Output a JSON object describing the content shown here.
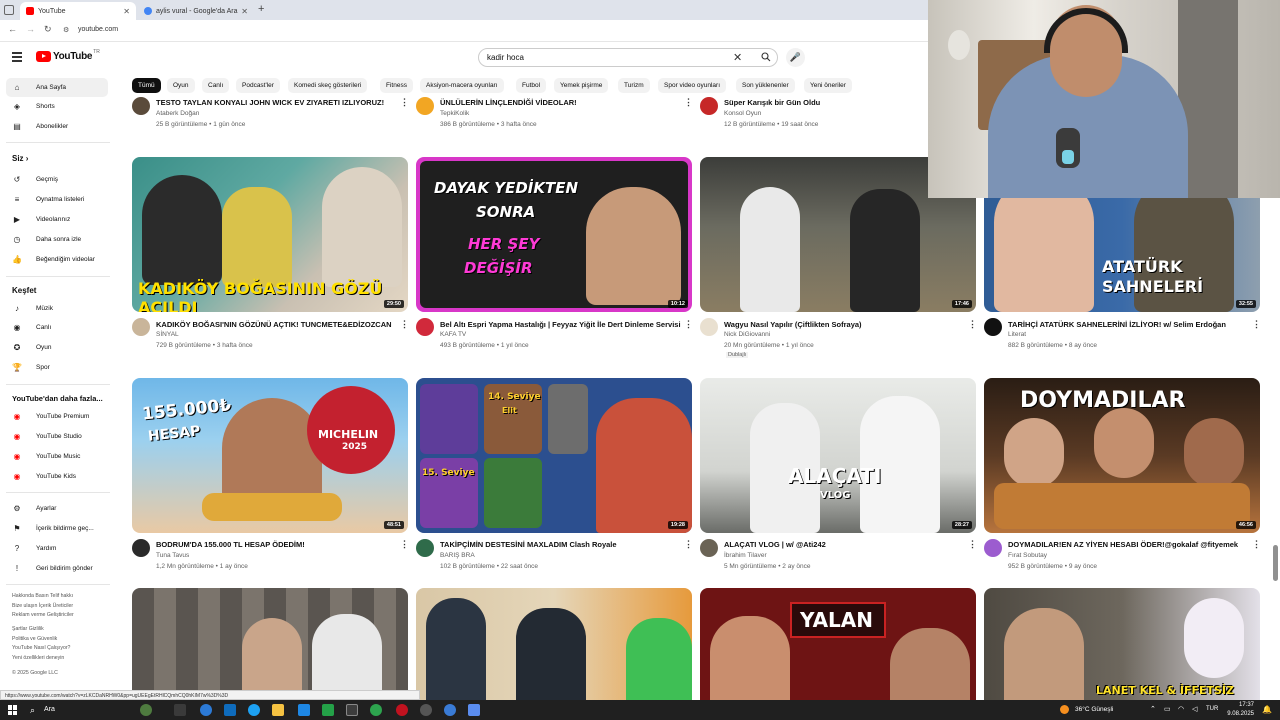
{
  "browser": {
    "tabs": [
      {
        "label": "YouTube",
        "active": true
      },
      {
        "label": "aylis vural - Google'da Ara",
        "active": false
      }
    ],
    "url": "youtube.com"
  },
  "masthead": {
    "logo_text": "YouTube",
    "logo_region": "TR",
    "search_value": "kadir hoca"
  },
  "sidebar": {
    "main": [
      {
        "label": "Ana Sayfa",
        "icon": "home-icon",
        "selected": true
      },
      {
        "label": "Shorts",
        "icon": "shorts-icon"
      },
      {
        "label": "Abonelikler",
        "icon": "subscriptions-icon"
      }
    ],
    "you_header": "Siz",
    "you": [
      {
        "label": "Geçmiş",
        "icon": "history-icon"
      },
      {
        "label": "Oynatma listeleri",
        "icon": "playlists-icon"
      },
      {
        "label": "Videolarınız",
        "icon": "your-videos-icon"
      },
      {
        "label": "Daha sonra izle",
        "icon": "watch-later-icon"
      },
      {
        "label": "Beğendiğim videolar",
        "icon": "liked-icon"
      }
    ],
    "explore_header": "Keşfet",
    "explore": [
      {
        "label": "Müzik",
        "icon": "music-icon"
      },
      {
        "label": "Canlı",
        "icon": "live-icon"
      },
      {
        "label": "Oyun",
        "icon": "gaming-icon"
      },
      {
        "label": "Spor",
        "icon": "sports-icon"
      }
    ],
    "more_header": "YouTube'dan daha fazla...",
    "more": [
      {
        "label": "YouTube Premium"
      },
      {
        "label": "YouTube Studio"
      },
      {
        "label": "YouTube Music"
      },
      {
        "label": "YouTube Kids"
      }
    ],
    "settings": [
      {
        "label": "Ayarlar",
        "icon": "settings-icon"
      },
      {
        "label": "İçerik bildirme geç...",
        "icon": "flag-icon"
      },
      {
        "label": "Yardım",
        "icon": "help-icon"
      },
      {
        "label": "Geri bildirim gönder",
        "icon": "feedback-icon"
      }
    ],
    "footer1": "Hakkında  Basın  Telif hakkı",
    "footer2": "Bize ulaşın  İçerik Üreticiler",
    "footer3": "Reklam verme  Geliştiriciler",
    "footer4": "Şartlar  Gizlilik",
    "footer5": "Politika ve Güvenlik",
    "footer6": "YouTube Nasıl Çalışıyor?",
    "footer7": "Yeni özellikleri deneyin",
    "copyright": "© 2025 Google LLC"
  },
  "chips": [
    "Tümü",
    "Oyun",
    "Canlı",
    "Podcast'ler",
    "Komedi skeç gösterileri",
    "Fitness",
    "Aksiyon-macera oyunları",
    "Futbol",
    "Yemek pişirme",
    "Turizm",
    "Spor video oyunları",
    "Son yüklenenler",
    "Yeni öneriler"
  ],
  "row0": [
    {
      "title": "TESTO TAYLAN KONYALI JOHN WICK EV ZIYARETI IZLIYORUZ!",
      "channel": "Ataberk Doğan",
      "meta": "25 B görüntüleme • 1 gün önce"
    },
    {
      "title": "ÜNLÜLERİN LİNÇLENDİĞİ VİDEOLAR!",
      "channel": "TepkiKolik",
      "meta": "386 B görüntüleme • 3 hafta önce"
    },
    {
      "title": "Süper Karışık bir Gün Oldu",
      "channel": "Konsol Oyun",
      "meta": "12 B görüntüleme • 19 saat önce"
    }
  ],
  "row1": [
    {
      "title": "KADIKÖY BOĞASI'NIN GÖZÜNÜ AÇTIK! TUNCMETE&EDİZOZCAN",
      "channel": "SİNYAL",
      "meta": "729 B görüntüleme • 3 hafta önce",
      "duration": "29:50",
      "overlay": "KADIKÖY BOĞASININ GÖZÜ AÇILDI"
    },
    {
      "title": "Bel Altı Espri Yapma Hastalığı | Feyyaz Yiğit İle Dert Dinleme Servisi",
      "channel": "KAFA TV",
      "meta": "493 B görüntüleme • 1 yıl önce",
      "duration": "10:12",
      "overlay1": "DAYAK YEDİKTEN",
      "overlay2": "SONRA",
      "overlay3": "HER ŞEY",
      "overlay4": "DEĞİŞİR"
    },
    {
      "title": "Wagyu Nasıl Yapılır (Çiftlikten Sofraya)",
      "channel": "Nick DiGiovanni",
      "meta": "20 Mn görüntüleme • 1 yıl önce",
      "badge": "Dublajlı",
      "duration": "17:46"
    },
    {
      "title": "TARİHÇİ ATATÜRK SAHNELERİNİ İZLİYOR! w/ Selim Erdoğan",
      "channel": "Literat",
      "meta": "882 B görüntüleme • 8 ay önce",
      "duration": "32:55",
      "overlay1": "ATATÜRK",
      "overlay2": "SAHNELERİ"
    }
  ],
  "row2": [
    {
      "title": "BODRUM'DA 155.000 TL HESAP ÖDEDİM!",
      "channel": "Tuna Tavus",
      "meta": "1,2 Mn görüntüleme • 1 ay önce",
      "duration": "48:51",
      "overlay1": "155.000₺",
      "overlay2": "HESAP",
      "overlay3": "MICHELIN",
      "overlay4": "2025"
    },
    {
      "title": "TAKİPÇİMİN DESTESİNİ MAXLADIM Clash Royale",
      "channel": "BARIŞ BRA",
      "meta": "102 B görüntüleme • 22 saat önce",
      "duration": "19:28",
      "overlay1": "14. Seviye",
      "overlay2": "15. Seviye",
      "overlay3": "Elit"
    },
    {
      "title": "ALAÇATI VLOG | w/ @Ati242",
      "channel": "İbrahim Tilaver",
      "meta": "5 Mn görüntüleme • 2 ay önce",
      "duration": "28:27",
      "overlay1": "ALAÇATI",
      "overlay2": "VLOG"
    },
    {
      "title": "DOYMADILAR!EN AZ YİYEN HESABI ÖDER!@gokalaf @fityemek",
      "channel": "Fırat Sobutay",
      "meta": "952 B görüntüleme • 9 ay önce",
      "duration": "46:56",
      "overlay1": "DOYMADILAR"
    }
  ],
  "row3": [
    {
      "overlay": ""
    },
    {
      "overlay": ""
    },
    {
      "overlay": "YALAN"
    },
    {
      "overlay": "LANET KEL & İFFETSİZ"
    }
  ],
  "status_url": "https://www.youtube.com/watch?v=zLKCDaNRHW0&pp=ugUEEgEtRHlCQmhCQ0hKIM7w%3D%3D",
  "taskbar": {
    "search": "Ara",
    "weather": "36°C  Güneşli",
    "lang": "TUR",
    "time": "17:37",
    "date": "9.08.2025"
  }
}
